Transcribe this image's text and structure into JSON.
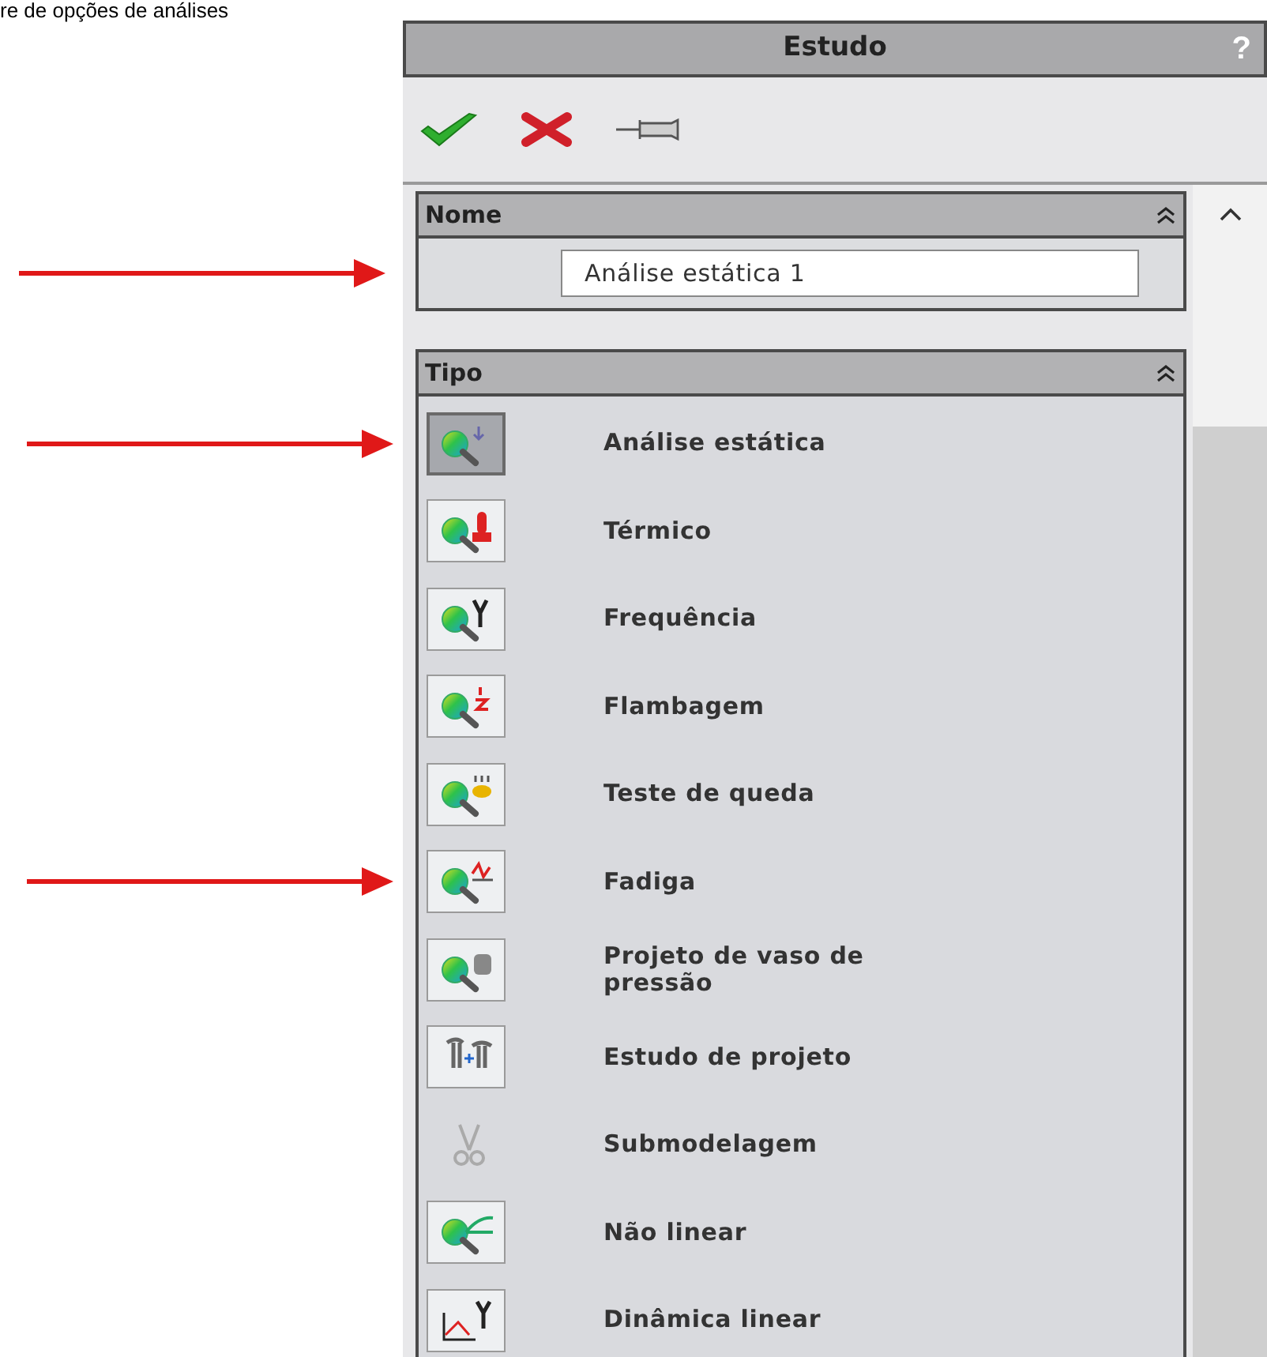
{
  "caption": "re de opções de análises",
  "panel": {
    "title": "Estudo",
    "help": "?"
  },
  "toolbar": [
    {
      "kind": "ok"
    },
    {
      "kind": "cancel"
    },
    {
      "kind": "pin"
    }
  ],
  "name_section": {
    "title": "Nome",
    "value": "Análise estática 1",
    "marked": true
  },
  "type_section": {
    "title": "Tipo",
    "items": [
      {
        "label": "Análise estática",
        "selected": true,
        "marked": true
      },
      {
        "label": "Térmico",
        "selected": false,
        "marked": false
      },
      {
        "label": "Frequência",
        "selected": false,
        "marked": false
      },
      {
        "label": "Flambagem",
        "selected": false,
        "marked": false
      },
      {
        "label": "Teste de queda",
        "selected": false,
        "marked": false
      },
      {
        "label": "Fadiga",
        "selected": false,
        "marked": true
      },
      {
        "label": "Projeto de vaso de pressão",
        "selected": false,
        "marked": false
      },
      {
        "label": "Estudo de projeto",
        "selected": false,
        "marked": false
      },
      {
        "label": "Submodelagem",
        "selected": false,
        "marked": false
      },
      {
        "label": "Não linear",
        "selected": false,
        "marked": false
      },
      {
        "label": "Dinâmica linear",
        "selected": false,
        "marked": false
      }
    ]
  }
}
